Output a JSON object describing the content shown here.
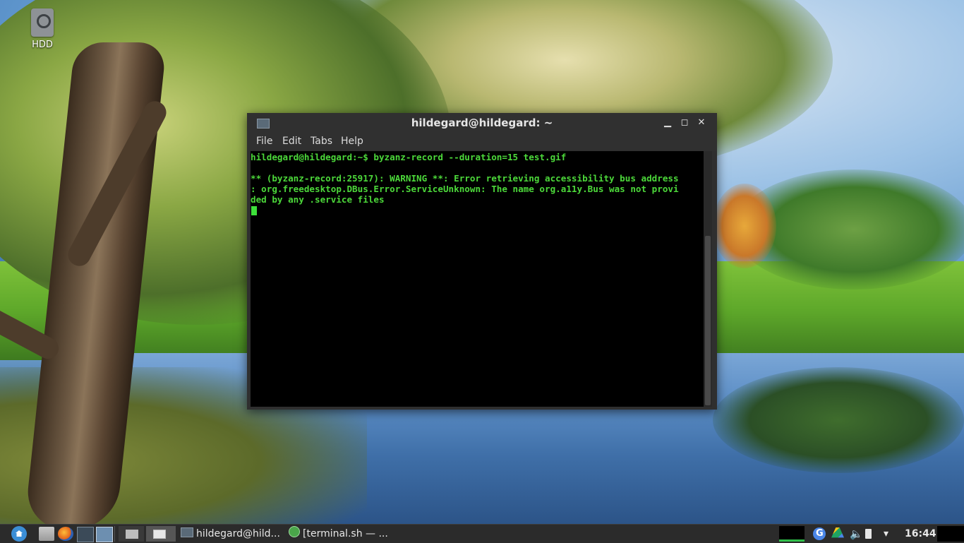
{
  "desktop": {
    "icons": [
      {
        "label": "HDD",
        "icon": "drive-icon"
      }
    ]
  },
  "terminal": {
    "title": "hildegard@hildegard: ~",
    "menu": [
      "File",
      "Edit",
      "Tabs",
      "Help"
    ],
    "lines": [
      "hildegard@hildegard:~$ byzanz-record --duration=15 test.gif",
      "",
      "** (byzanz-record:25917): WARNING **: Error retrieving accessibility bus address",
      ": org.freedesktop.DBus.Error.ServiceUnknown: The name org.a11y.Bus was not provi",
      "ded by any .service files"
    ],
    "colors": {
      "text": "#4cd83a",
      "background": "#000000",
      "cursor": "#3ee03a"
    },
    "window_buttons": [
      "minimize-icon",
      "maximize-icon",
      "close-icon"
    ]
  },
  "taskbar": {
    "launchers": [
      "start-menu-icon",
      "file-manager-icon",
      "firefox-icon",
      "terminal-icon",
      "show-desktop-icon"
    ],
    "tasks": [
      {
        "label": "hildegard@hild...",
        "icon": "terminal-window-icon"
      },
      {
        "label": "[terminal.sh — ...",
        "icon": "script-icon"
      }
    ],
    "tray": {
      "icons": [
        "google-icon",
        "google-drive-icon",
        "volume-icon",
        "battery-icon",
        "wifi-icon"
      ],
      "clock": "16:44"
    }
  }
}
